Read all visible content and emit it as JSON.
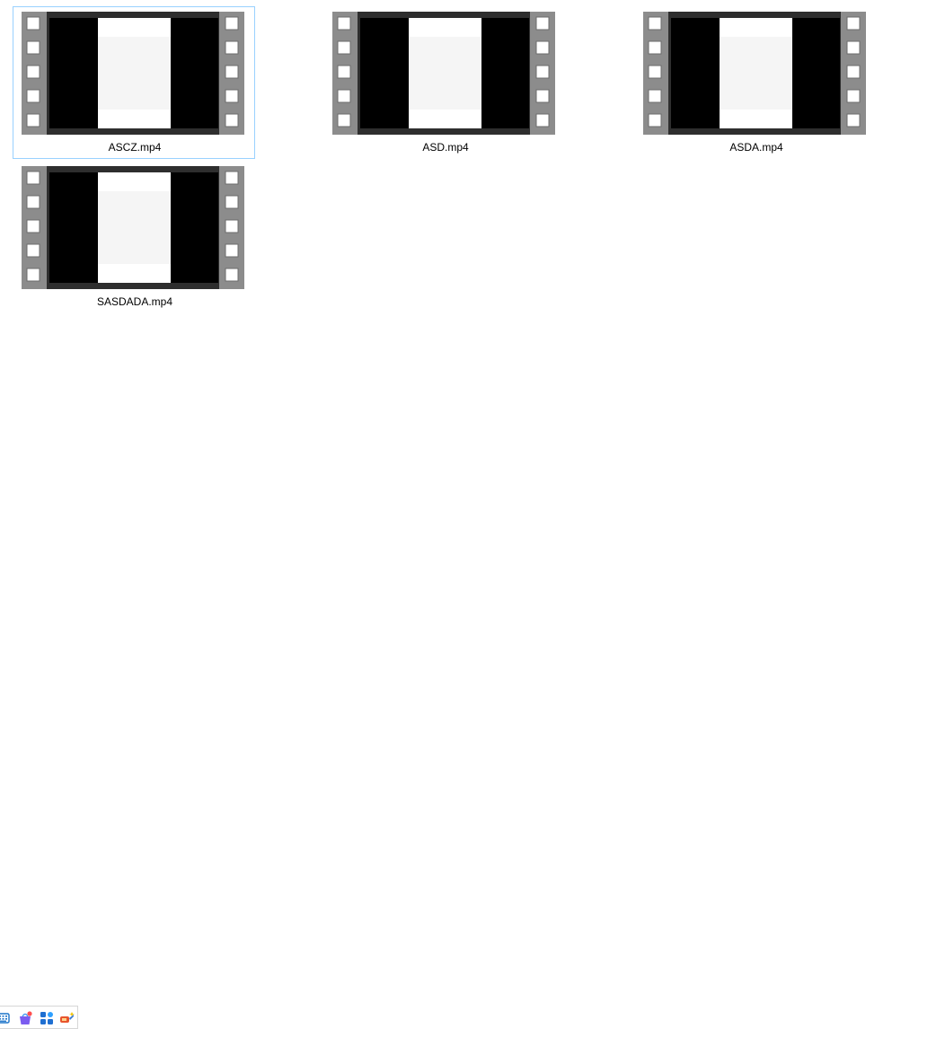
{
  "files": [
    {
      "name": "ASCZ.mp4",
      "selected": true,
      "icon": "video-file-icon"
    },
    {
      "name": "ASD.mp4",
      "selected": false,
      "icon": "video-file-icon"
    },
    {
      "name": "ASDA.mp4",
      "selected": false,
      "icon": "video-file-icon"
    },
    {
      "name": "SASDADA.mp4",
      "selected": false,
      "icon": "video-file-icon"
    }
  ],
  "tray": {
    "icons": [
      "keyboard-icon",
      "app-store-icon",
      "widgets-icon",
      "tools-icon"
    ]
  },
  "colors": {
    "selection_border": "#99d1ff",
    "film_border": "#8c8c8c",
    "film_frame": "#2e2e2e",
    "film_black": "#000000",
    "film_white": "#ffffff"
  }
}
